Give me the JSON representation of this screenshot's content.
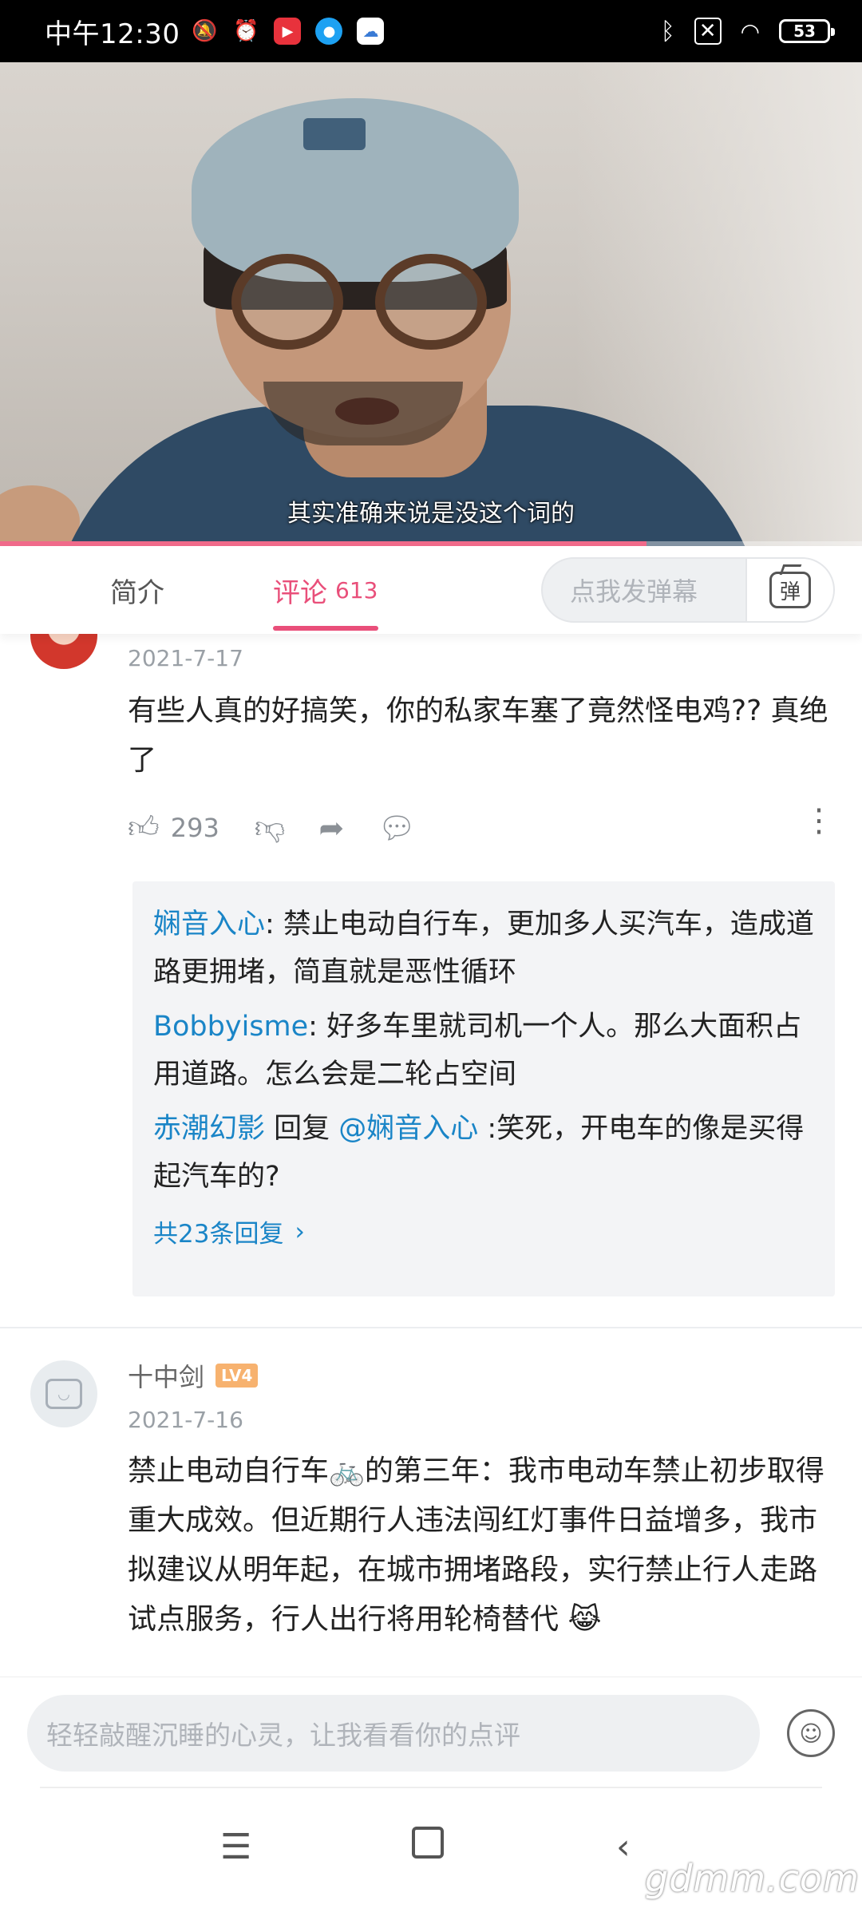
{
  "status_bar": {
    "time": "中午12:30",
    "battery": "53"
  },
  "video": {
    "subtitle": "其实准确来说是没这个词的",
    "progress_fraction": 0.75
  },
  "tabs": {
    "intro_label": "简介",
    "comments_label": "评论",
    "comments_count": "613"
  },
  "danmaku": {
    "placeholder": "点我发弹幕",
    "button_glyph": "弹"
  },
  "comments": [
    {
      "date": "2021-7-17",
      "text": "有些人真的好搞笑，你的私家车塞了竟然怪电鸡?? 真绝了",
      "likes": "293",
      "replies": [
        {
          "user": "娴音入心",
          "text": ": 禁止电动自行车，更加多人买汽车，造成道路更拥堵，简直就是恶性循环"
        },
        {
          "user": "Bobbyisme",
          "text": ": 好多车里就司机一个人。那么大面积占用道路。怎么会是二轮占空间"
        },
        {
          "user": "赤潮幻影",
          "reply_word": " 回复 ",
          "mention": "@娴音入心",
          "text": " :笑死，开电车的像是买得起汽车的?"
        }
      ],
      "more_replies": "共23条回复"
    },
    {
      "username": "十中剑",
      "level": "LV4",
      "date": "2021-7-16",
      "text": "禁止电动自行车🚲的第三年：我市电动车禁止初步取得重大成效。但近期行人违法闯红灯事件日益增多，我市拟建议从明年起，在城市拥堵路段，实行禁止行人走路试点服务，行人出行将用轮椅替代 😹"
    }
  ],
  "input_bar": {
    "placeholder": "轻轻敲醒沉睡的心灵，让我看看你的点评"
  },
  "watermark": "gdmm.com"
}
